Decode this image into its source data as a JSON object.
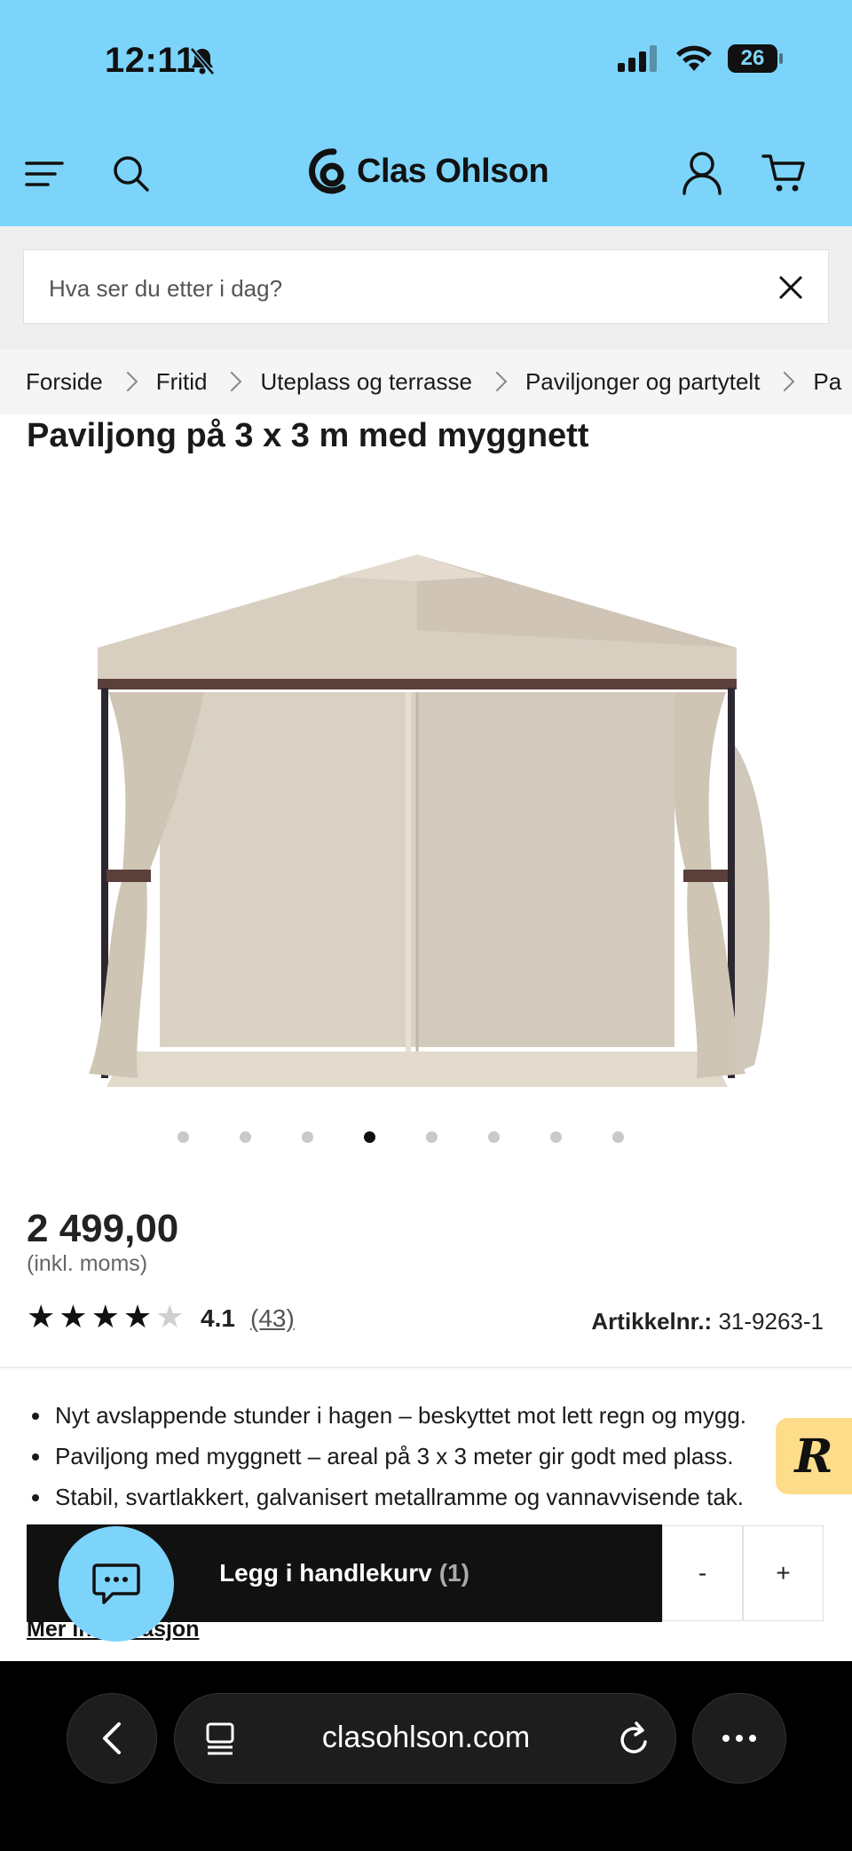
{
  "status_bar": {
    "time": "12:11",
    "battery": "26"
  },
  "header": {
    "brand": "Clas Ohlson"
  },
  "search": {
    "placeholder": "Hva ser du etter i dag?"
  },
  "breadcrumb": [
    "Forside",
    "Fritid",
    "Uteplass og terrasse",
    "Paviljonger og partytelt",
    "Pa"
  ],
  "product": {
    "title": "Paviljong på 3 x 3 m med myggnett",
    "image_count": 8,
    "active_image": 4,
    "price": "2 499,00",
    "vat_note": "(inkl. moms)",
    "rating_value": 4.1,
    "rating": "4.1",
    "reviews": "(43)",
    "sku_label": "Artikkelnr.:",
    "sku": "31-9263-1",
    "bullets": [
      "Nyt avslappende stunder i hagen – beskyttet mot lett regn og mygg.",
      "Paviljong med myggnett – areal på 3 x 3 meter gir godt med plass.",
      "Stabil, svartlakkert, galvanisert metallramme og vannavvisende tak."
    ]
  },
  "cart": {
    "add_label": "Legg i handlekurv",
    "count": "(1)",
    "minus": "-",
    "plus": "+"
  },
  "more_info": "Mer informasjon",
  "badge": {
    "letter": "R"
  },
  "browser": {
    "url": "clasohlson.com"
  },
  "colors": {
    "header_bg": "#7dd4fb",
    "button_bg": "#111111",
    "badge_bg": "#fddc8a"
  }
}
